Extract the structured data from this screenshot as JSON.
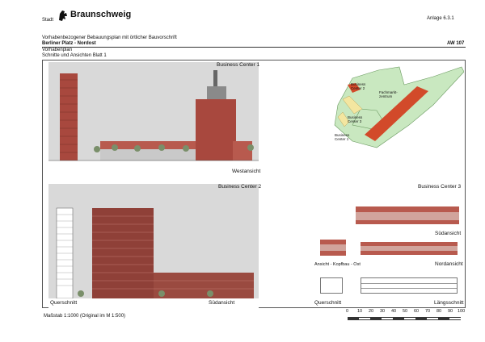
{
  "header": {
    "city_prefix": "Stadt",
    "city_name": "Braunschweig",
    "annex": "Anlage 6.3.1"
  },
  "plan": {
    "line1": "Vorhabenbezogener Bebauungsplan mit örtlicher Bauvorschrift",
    "line2": "Berliner Platz - Nordost",
    "code": "AW 107",
    "line3": "Vorhabenplan",
    "line4": "Schnitte und Ansichten Blatt 1"
  },
  "sections": {
    "bc1_title": "Business Center 1",
    "bc1_view": "Westansicht",
    "bc2_title": "Business Center 2",
    "bc2_view_left": "Querschnitt",
    "bc2_view_right": "Südansicht",
    "bc3_title": "Business Center 3",
    "bc3_sud": "Südansicht",
    "bc3_kopfbau": "Ansicht - Kopfbau - Ost",
    "bc3_nord": "Nordansicht",
    "bc3_quer": "Querschnitt",
    "bc3_laengs": "Längsschnitt"
  },
  "site_map": {
    "labels": {
      "bc2": "Business Center 2",
      "fachmarkt": "Fachmarkt-zentrum",
      "bc3": "Business Center 3",
      "bc1": "Business Center 1"
    },
    "colors": {
      "green": "#c9e8c0",
      "red": "#d24a2a",
      "yellow": "#f3e6a0"
    }
  },
  "footer": {
    "scale_text": "Maßstab 1:1000 (Original im M 1:500)",
    "scale_ticks": [
      "0",
      "10",
      "20",
      "30",
      "40",
      "50",
      "60",
      "70",
      "80",
      "90",
      "100"
    ]
  },
  "colors": {
    "building_red": "#a8483e",
    "panel_gray": "#d9d9d9"
  }
}
